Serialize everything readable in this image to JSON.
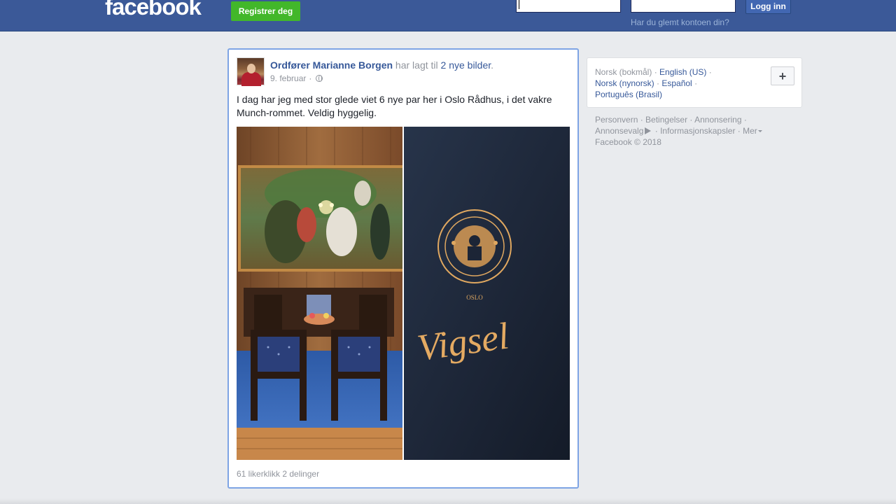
{
  "header": {
    "logo_text": "facebook",
    "register_label": "Registrer deg",
    "email_value": "",
    "password_value": "",
    "login_label": "Logg inn",
    "forgot_label": "Har du glemt kontoen din?"
  },
  "post": {
    "author": "Ordfører Marianne Borgen",
    "action_prefix": " har lagt til ",
    "action_link": "2 nye bilder",
    "action_suffix": ".",
    "date": "9. februar",
    "date_separator": "·",
    "privacy_icon": "globe-icon",
    "text": "I dag har jeg med stor glede viet 6 nye par her i Oslo Rådhus, i det vakre Munch-rommet. Veldig hyggelig.",
    "photo_right_caption": "Vigsel",
    "photo_right_seal_text": "UNANIMITER ET CONSTANTER · OSLO",
    "likes": "61 likerklikk",
    "shares": "2 delinger"
  },
  "sidebar": {
    "languages": [
      {
        "label": "Norsk (bokmål)",
        "current": true
      },
      {
        "label": "English (US)",
        "current": false
      },
      {
        "label": "Norsk (nynorsk)",
        "current": false
      },
      {
        "label": "Español",
        "current": false
      },
      {
        "label": "Português (Brasil)",
        "current": false
      }
    ],
    "add_language_label": "+",
    "footer": {
      "privacy": "Personvern",
      "terms": "Betingelser",
      "advertising": "Annonsering",
      "adchoices": "Annonsevalg",
      "cookies": "Informasjonskapsler",
      "more": "Mer",
      "copyright": "Facebook © 2018"
    }
  },
  "colors": {
    "brand_blue": "#3b5998",
    "link_blue": "#365899",
    "register_green": "#42b72a",
    "page_bg": "#e9ebee"
  }
}
